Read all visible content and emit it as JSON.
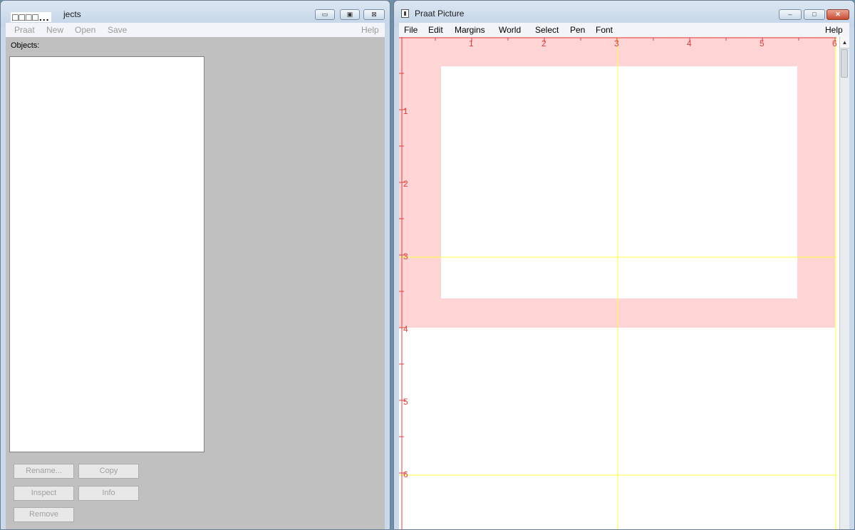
{
  "objects_window": {
    "title": "Praat Objects",
    "title_visible": "jects",
    "corner_glyphs": "□□□□...",
    "menu": [
      "Praat",
      "New",
      "Open",
      "Save"
    ],
    "help": "Help",
    "objects_label": "Objects:",
    "buttons": {
      "rename": "Rename...",
      "copy": "Copy",
      "inspect": "Inspect",
      "info": "Info",
      "remove": "Remove"
    }
  },
  "picture_window": {
    "title": "Praat Picture",
    "menu": [
      "File",
      "Edit",
      "Margins",
      "World",
      "Select",
      "Pen",
      "Font"
    ],
    "help": "Help",
    "controls": {
      "minimize": "–",
      "maximize": "□",
      "close": "✕"
    },
    "ruler": {
      "x_labels": [
        "1",
        "2",
        "3",
        "4",
        "5",
        "6"
      ],
      "y_labels": [
        "1",
        "2",
        "3",
        "4",
        "5",
        "6"
      ],
      "color": "#e04040"
    },
    "selection": {
      "x": [
        0,
        6
      ],
      "y": [
        0,
        4
      ],
      "color": "#ffd4d4"
    },
    "viewport": {
      "x": [
        0.5,
        5.5
      ],
      "y": [
        0.5,
        3.5
      ],
      "color": "#ffffff"
    },
    "guide_color": "#ffff40",
    "guides_x": [
      3,
      6
    ],
    "guides_y": [
      3,
      6
    ]
  },
  "scroll_up": "▲"
}
